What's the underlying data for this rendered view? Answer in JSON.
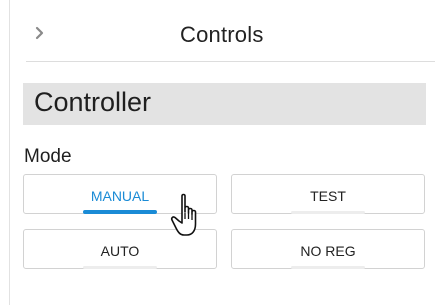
{
  "header": {
    "title": "Controls",
    "back_icon": "chevron-right-icon"
  },
  "section": {
    "title": "Controller"
  },
  "mode": {
    "label": "Mode",
    "selected": "MANUAL",
    "options": [
      {
        "label": "MANUAL",
        "active": true
      },
      {
        "label": "TEST",
        "active": false
      },
      {
        "label": "AUTO",
        "active": false
      },
      {
        "label": "NO REG",
        "active": false
      }
    ]
  },
  "colors": {
    "accent": "#1a8bd6",
    "section_bg": "#e3e3e3",
    "border": "#d2d2d2"
  },
  "cursor_icon": "hand-pointer-icon"
}
